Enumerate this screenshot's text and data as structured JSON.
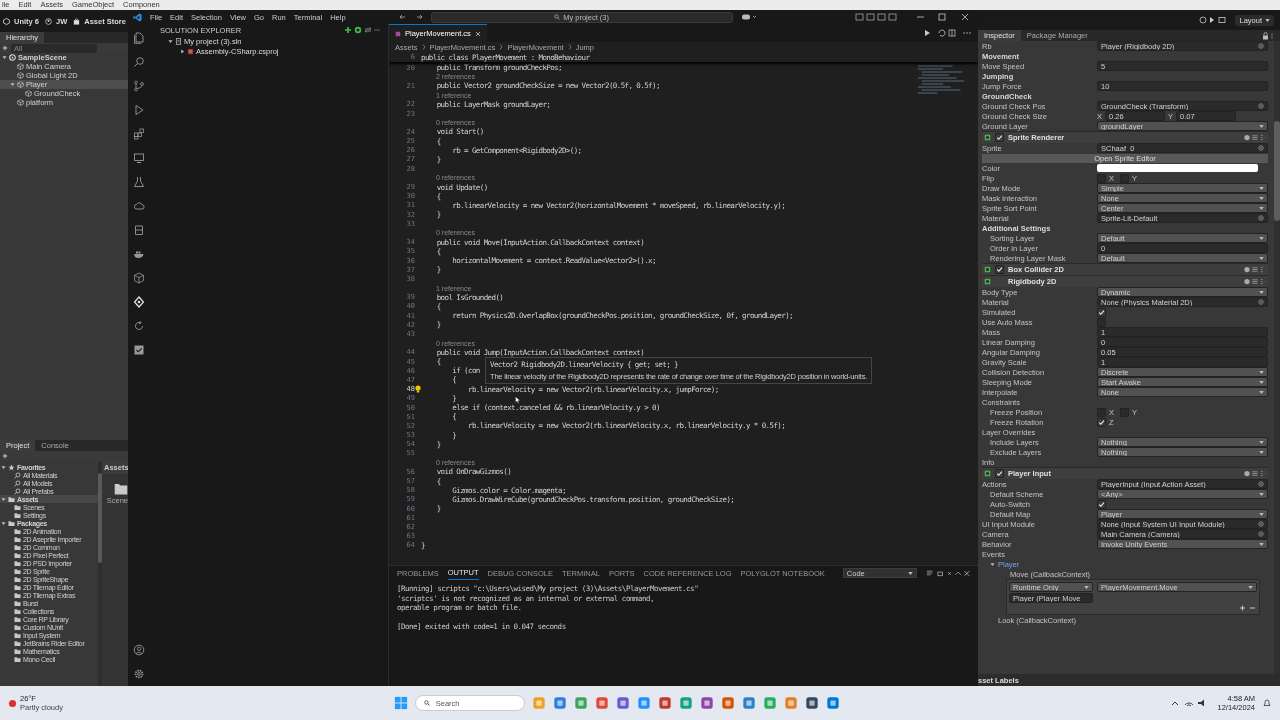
{
  "unity_menu": [
    "ile",
    "Edit",
    "Assets",
    "GameObject",
    "Componen"
  ],
  "unity_toolbar": {
    "logo": "Unity 6",
    "account": "JW",
    "store": "Asset Store",
    "layout": "Layout"
  },
  "hierarchy": {
    "tab": "Hierarchy",
    "search_placeholder": "All",
    "items": [
      {
        "label": "SampleScene",
        "kind": "scene",
        "expanded": true,
        "selected": false,
        "children": [
          {
            "label": "Main Camera",
            "kind": "object",
            "selected": false
          },
          {
            "label": "Global Light 2D",
            "kind": "object",
            "selected": false
          },
          {
            "label": "Player",
            "kind": "object",
            "expanded": true,
            "selected": true,
            "children": [
              {
                "label": "GroundCheck",
                "kind": "object",
                "selected": false
              }
            ]
          },
          {
            "label": "platform",
            "kind": "object",
            "selected": false
          }
        ]
      }
    ]
  },
  "project": {
    "tabs": [
      {
        "label": "Project",
        "selected": true
      },
      {
        "label": "Console",
        "selected": false
      }
    ],
    "items": [
      {
        "label": "Favorites",
        "kind": "favorites",
        "expanded": true,
        "selected": false,
        "children": [
          {
            "label": "All Materials",
            "kind": "search",
            "selected": false
          },
          {
            "label": "All Models",
            "kind": "search",
            "selected": false
          },
          {
            "label": "All Prefabs",
            "kind": "search",
            "selected": false
          }
        ]
      },
      {
        "label": "Assets",
        "kind": "folder",
        "expanded": true,
        "selected": true,
        "children": [
          {
            "label": "Scenes",
            "kind": "folder",
            "selected": false
          },
          {
            "label": "Settings",
            "kind": "folder",
            "selected": false
          }
        ]
      },
      {
        "label": "Packages",
        "kind": "folder",
        "expanded": true,
        "selected": false,
        "children": [
          {
            "label": "2D Animation",
            "kind": "folder",
            "selected": false
          },
          {
            "label": "2D Aseprite Importer",
            "kind": "folder",
            "selected": false
          },
          {
            "label": "2D Common",
            "kind": "folder",
            "selected": false
          },
          {
            "label": "2D Pixel Perfect",
            "kind": "folder",
            "selected": false
          },
          {
            "label": "2D PSD Importer",
            "kind": "folder",
            "selected": false
          },
          {
            "label": "2D Sprite",
            "kind": "folder",
            "selected": false
          },
          {
            "label": "2D SpriteShape",
            "kind": "folder",
            "selected": false
          },
          {
            "label": "2D Tilemap Editor",
            "kind": "folder",
            "selected": false
          },
          {
            "label": "2D Tilemap Extras",
            "kind": "folder",
            "selected": false
          },
          {
            "label": "Burst",
            "kind": "folder",
            "selected": false
          },
          {
            "label": "Collections",
            "kind": "folder",
            "selected": false
          },
          {
            "label": "Core RP Library",
            "kind": "folder",
            "selected": false
          },
          {
            "label": "Custom NUnit",
            "kind": "folder",
            "selected": false
          },
          {
            "label": "Input System",
            "kind": "folder",
            "selected": false
          },
          {
            "label": "JetBrains Rider Editor",
            "kind": "folder",
            "selected": false
          },
          {
            "label": "Mathematics",
            "kind": "folder",
            "selected": false
          },
          {
            "label": "Mono Cecil",
            "kind": "folder",
            "selected": false
          }
        ]
      }
    ],
    "content_header": "Assets",
    "content_items": [
      {
        "label": "Scene"
      }
    ]
  },
  "vscode": {
    "menu": [
      "File",
      "Edit",
      "Selection",
      "View",
      "Go",
      "Run",
      "Terminal",
      "Help"
    ],
    "search": "My project (3)",
    "explorer": {
      "title": "SOLUTION EXPLORER",
      "items": [
        {
          "label": "My project (3).sln",
          "kind": "solution",
          "expanded": true,
          "children": [
            {
              "label": "Assembly-CSharp.csproj",
              "kind": "project",
              "expanded": false
            }
          ]
        }
      ]
    },
    "tab": {
      "label": "PlayerMovement.cs"
    },
    "breadcrumbs": [
      "Assets",
      "PlayerMovement.cs",
      "PlayerMovement",
      "Jump"
    ],
    "sticky": {
      "number": "6",
      "text": "public class PlayerMovement : MonoBehaviour"
    },
    "lines": [
      {
        "kind": "code",
        "number": "20",
        "text": "    public Transform groundCheckPos;"
      },
      {
        "kind": "lens",
        "text": "2 references"
      },
      {
        "kind": "code",
        "number": "21",
        "text": "    public Vector2 groundCheckSize = new Vector2(0.5f, 0.5f);"
      },
      {
        "kind": "lens",
        "text": "1 reference"
      },
      {
        "kind": "code",
        "number": "22",
        "text": "    public LayerMask groundLayer;"
      },
      {
        "kind": "code",
        "number": "23"
      },
      {
        "kind": "lens",
        "text": "0 references"
      },
      {
        "kind": "code",
        "number": "24",
        "text": "    void Start()"
      },
      {
        "kind": "code",
        "number": "25",
        "text": "    {"
      },
      {
        "kind": "code",
        "number": "26",
        "text": "        rb = GetComponent<Rigidbody2D>();"
      },
      {
        "kind": "code",
        "number": "27",
        "text": "    }"
      },
      {
        "kind": "code",
        "number": "28"
      },
      {
        "kind": "lens",
        "text": "0 references"
      },
      {
        "kind": "code",
        "number": "29",
        "text": "    void Update()"
      },
      {
        "kind": "code",
        "number": "30",
        "text": "    {"
      },
      {
        "kind": "code",
        "number": "31",
        "text": "        rb.linearVelocity = new Vector2(horizontalMovement * moveSpeed, rb.linearVelocity.y);"
      },
      {
        "kind": "code",
        "number": "32",
        "text": "    }"
      },
      {
        "kind": "code",
        "number": "33"
      },
      {
        "kind": "lens",
        "text": "0 references"
      },
      {
        "kind": "code",
        "number": "34",
        "text": "    public void Move(InputAction.CallbackContext context)"
      },
      {
        "kind": "code",
        "number": "35",
        "text": "    {"
      },
      {
        "kind": "code",
        "number": "36",
        "text": "        horizontalMovement = context.ReadValue<Vector2>().x;"
      },
      {
        "kind": "code",
        "number": "37",
        "text": "    }"
      },
      {
        "kind": "code",
        "number": "38"
      },
      {
        "kind": "lens",
        "text": "1 reference"
      },
      {
        "kind": "code",
        "number": "39",
        "text": "    bool IsGrounded()"
      },
      {
        "kind": "code",
        "number": "40",
        "text": "    {"
      },
      {
        "kind": "code",
        "number": "41",
        "text": "        return Physics2D.OverlapBox(groundCheckPos.position, groundCheckSize, 0f, groundLayer);"
      },
      {
        "kind": "code",
        "number": "42",
        "text": "    }"
      },
      {
        "kind": "code",
        "number": "43"
      },
      {
        "kind": "lens",
        "text": "0 references"
      },
      {
        "kind": "code",
        "number": "44",
        "text": "    public void Jump(InputAction.CallbackContext context)"
      },
      {
        "kind": "code",
        "number": "45",
        "text": "    {"
      },
      {
        "kind": "code",
        "number": "46",
        "text": "        if (con"
      },
      {
        "kind": "code",
        "number": "47",
        "text": "        {"
      },
      {
        "kind": "current",
        "number": "48",
        "text": "            rb.linearVelocity = new Vector2(rb.linearVelocity.x, jumpForce);"
      },
      {
        "kind": "code",
        "number": "49",
        "text": "        }"
      },
      {
        "kind": "code",
        "number": "50",
        "text": "        else if (context.canceled && rb.linearVelocity.y > 0)"
      },
      {
        "kind": "code",
        "number": "51",
        "text": "        {"
      },
      {
        "kind": "code",
        "number": "52",
        "text": "            rb.linearVelocity = new Vector2(rb.linearVelocity.x, rb.linearVelocity.y * 0.5f);"
      },
      {
        "kind": "code",
        "number": "53",
        "text": "        }"
      },
      {
        "kind": "code",
        "number": "54",
        "text": "    }"
      },
      {
        "kind": "code",
        "number": "55"
      },
      {
        "kind": "lens",
        "text": "0 references"
      },
      {
        "kind": "code",
        "number": "56",
        "text": "    void OnDrawGizmos()"
      },
      {
        "kind": "code",
        "number": "57",
        "text": "    {"
      },
      {
        "kind": "code",
        "number": "58",
        "text": "        Gizmos.color = Color.magenta;"
      },
      {
        "kind": "code",
        "number": "59",
        "text": "        Gizmos.DrawWireCube(groundCheckPos.transform.position, groundCheckSize);"
      },
      {
        "kind": "code",
        "number": "60",
        "text": "    }"
      },
      {
        "kind": "code",
        "number": "61"
      },
      {
        "kind": "code",
        "number": "62"
      },
      {
        "kind": "code",
        "number": "63"
      },
      {
        "kind": "code",
        "number": "64",
        "text": "}"
      }
    ],
    "hover": {
      "signature": "Vector2 Rigidbody2D.linearVelocity { get; set; }",
      "description": "The linear velocity of the Rigidbody2D represents the rate of change over time of the Rigidbody2D position in world-units."
    },
    "panel": {
      "tabs": [
        {
          "label": "PROBLEMS",
          "selected": false
        },
        {
          "label": "OUTPUT",
          "selected": true
        },
        {
          "label": "DEBUG CONSOLE",
          "selected": false
        },
        {
          "label": "TERMINAL",
          "selected": false
        },
        {
          "label": "PORTS",
          "selected": false
        },
        {
          "label": "CODE REFERENCE LOG",
          "selected": false
        },
        {
          "label": "POLYGLOT NOTEBOOK",
          "selected": false
        }
      ],
      "channel": "Code",
      "output": [
        "[Running] scriptcs \"c:\\Users\\wised\\My project (3)\\Assets\\PlayerMovement.cs\"",
        "'scriptcs' is not recognized as an internal or external command,",
        "operable program or batch file."
      ],
      "result": "[Done] exited with code=1 in 0.047 seconds"
    }
  },
  "inspector": {
    "tabs": [
      {
        "label": "Inspector",
        "selected": true
      },
      {
        "label": "Package Manager",
        "selected": false
      }
    ],
    "rows": [
      {
        "kind": "object",
        "label": "Rb",
        "value": "Player (Rigidbody 2D)"
      },
      {
        "kind": "header",
        "label": "Movement"
      },
      {
        "kind": "text",
        "label": "Move Speed",
        "value": "5"
      },
      {
        "kind": "header",
        "label": "Jumping"
      },
      {
        "kind": "text",
        "label": "Jump Force",
        "value": "10"
      },
      {
        "kind": "header",
        "label": "GroundCheck"
      },
      {
        "kind": "object",
        "label": "Ground Check Pos",
        "value": "GroundCheck (Transform)"
      },
      {
        "kind": "vector",
        "label": "Ground Check Size",
        "axes": [
          {
            "label": "X",
            "value": "0.26"
          },
          {
            "label": "Y",
            "value": "0.07"
          }
        ]
      },
      {
        "kind": "dropdown",
        "label": "Ground Layer",
        "value": "groundLayer"
      },
      {
        "kind": "component",
        "label": "Sprite Renderer",
        "enabled": true
      },
      {
        "kind": "object",
        "label": "Sprite",
        "value": "SChaaf_0"
      },
      {
        "kind": "button",
        "label": "Open Sprite Editor"
      },
      {
        "kind": "color",
        "label": "Color",
        "color": "#ffffff"
      },
      {
        "kind": "flags",
        "label": "Flip",
        "flags": [
          {
            "label": "X",
            "checked": false
          },
          {
            "label": "Y",
            "checked": false
          }
        ]
      },
      {
        "kind": "dropdown",
        "label": "Draw Mode",
        "value": "Simple"
      },
      {
        "kind": "dropdown",
        "label": "Mask Interaction",
        "value": "None"
      },
      {
        "kind": "dropdown",
        "label": "Sprite Sort Point",
        "value": "Center"
      },
      {
        "kind": "object",
        "label": "Material",
        "value": "Sprite-Lit-Default"
      },
      {
        "kind": "header",
        "label": "Additional Settings",
        "children": [
          {
            "kind": "dropdown",
            "label": "Sorting Layer",
            "value": "Default"
          },
          {
            "kind": "text",
            "label": "Order in Layer",
            "value": "0"
          },
          {
            "kind": "dropdown",
            "label": "Rendering Layer Mask",
            "value": "Default"
          }
        ]
      },
      {
        "kind": "component",
        "label": "Box Collider 2D",
        "enabled": true
      },
      {
        "kind": "component",
        "label": "Rigidbody 2D"
      },
      {
        "kind": "dropdown",
        "label": "Body Type",
        "value": "Dynamic"
      },
      {
        "kind": "object",
        "label": "Material",
        "value": "None (Physics Material 2D)"
      },
      {
        "kind": "checkbox",
        "label": "Simulated",
        "checked": true
      },
      {
        "kind": "checkbox",
        "label": "Use Auto Mass",
        "checked": false
      },
      {
        "kind": "text",
        "label": "Mass",
        "value": "1"
      },
      {
        "kind": "text",
        "label": "Linear Damping",
        "value": "0"
      },
      {
        "kind": "text",
        "label": "Angular Damping",
        "value": "0.05"
      },
      {
        "kind": "text",
        "label": "Gravity Scale",
        "value": "1"
      },
      {
        "kind": "dropdown",
        "label": "Collision Detection",
        "value": "Discrete"
      },
      {
        "kind": "dropdown",
        "label": "Sleeping Mode",
        "value": "Start Awake"
      },
      {
        "kind": "dropdown",
        "label": "Interpolate",
        "value": "None"
      },
      {
        "kind": "label",
        "label": "Constraints",
        "children": [
          {
            "kind": "flags",
            "label": "Freeze Position",
            "flags": [
              {
                "label": "X",
                "checked": false
              },
              {
                "label": "Y",
                "checked": false
              }
            ]
          },
          {
            "kind": "flags",
            "label": "Freeze Rotation",
            "flags": [
              {
                "label": "Z",
                "checked": true
              }
            ]
          }
        ]
      },
      {
        "kind": "label",
        "label": "Layer Overrides",
        "children": [
          {
            "kind": "dropdown",
            "label": "Include Layers",
            "value": "Nothing"
          },
          {
            "kind": "dropdown",
            "label": "Exclude Layers",
            "value": "Nothing"
          }
        ]
      },
      {
        "kind": "label",
        "label": "Info"
      },
      {
        "kind": "component",
        "label": "Player Input",
        "enabled": true
      },
      {
        "kind": "object",
        "label": "Actions",
        "value": "PlayerInput (Input Action Asset)",
        "children": [
          {
            "kind": "dropdown",
            "label": "Default Scheme",
            "value": "<Any>"
          },
          {
            "kind": "checkbox",
            "label": "Auto-Switch",
            "checked": true
          },
          {
            "kind": "dropdown",
            "label": "Default Map",
            "value": "Player"
          }
        ]
      },
      {
        "kind": "object",
        "label": "UI Input Module",
        "value": "None (Input System UI Input Module)"
      },
      {
        "kind": "object",
        "label": "Camera",
        "value": "Main Camera (Camera)"
      },
      {
        "kind": "dropdown",
        "label": "Behavior",
        "value": "Invoke Unity Events"
      },
      {
        "kind": "label",
        "label": "Events",
        "children": [
          {
            "kind": "foldout",
            "label": "Player",
            "expanded": true,
            "children": [
              {
                "kind": "event",
                "label": "Move (CallbackContext)",
                "mode": "Runtime Only",
                "function": "PlayerMovement.Move",
                "target": "Player (Player Move"
              },
              {
                "kind": "label",
                "label": "Look (CallbackContext)"
              }
            ]
          }
        ]
      }
    ],
    "footer": "sset Labels"
  },
  "taskbar": {
    "temperature": "26°F",
    "weather": "Partly cloudy",
    "search_placeholder": "Search",
    "time": "4:58 AM",
    "date": "12/14/2024"
  }
}
